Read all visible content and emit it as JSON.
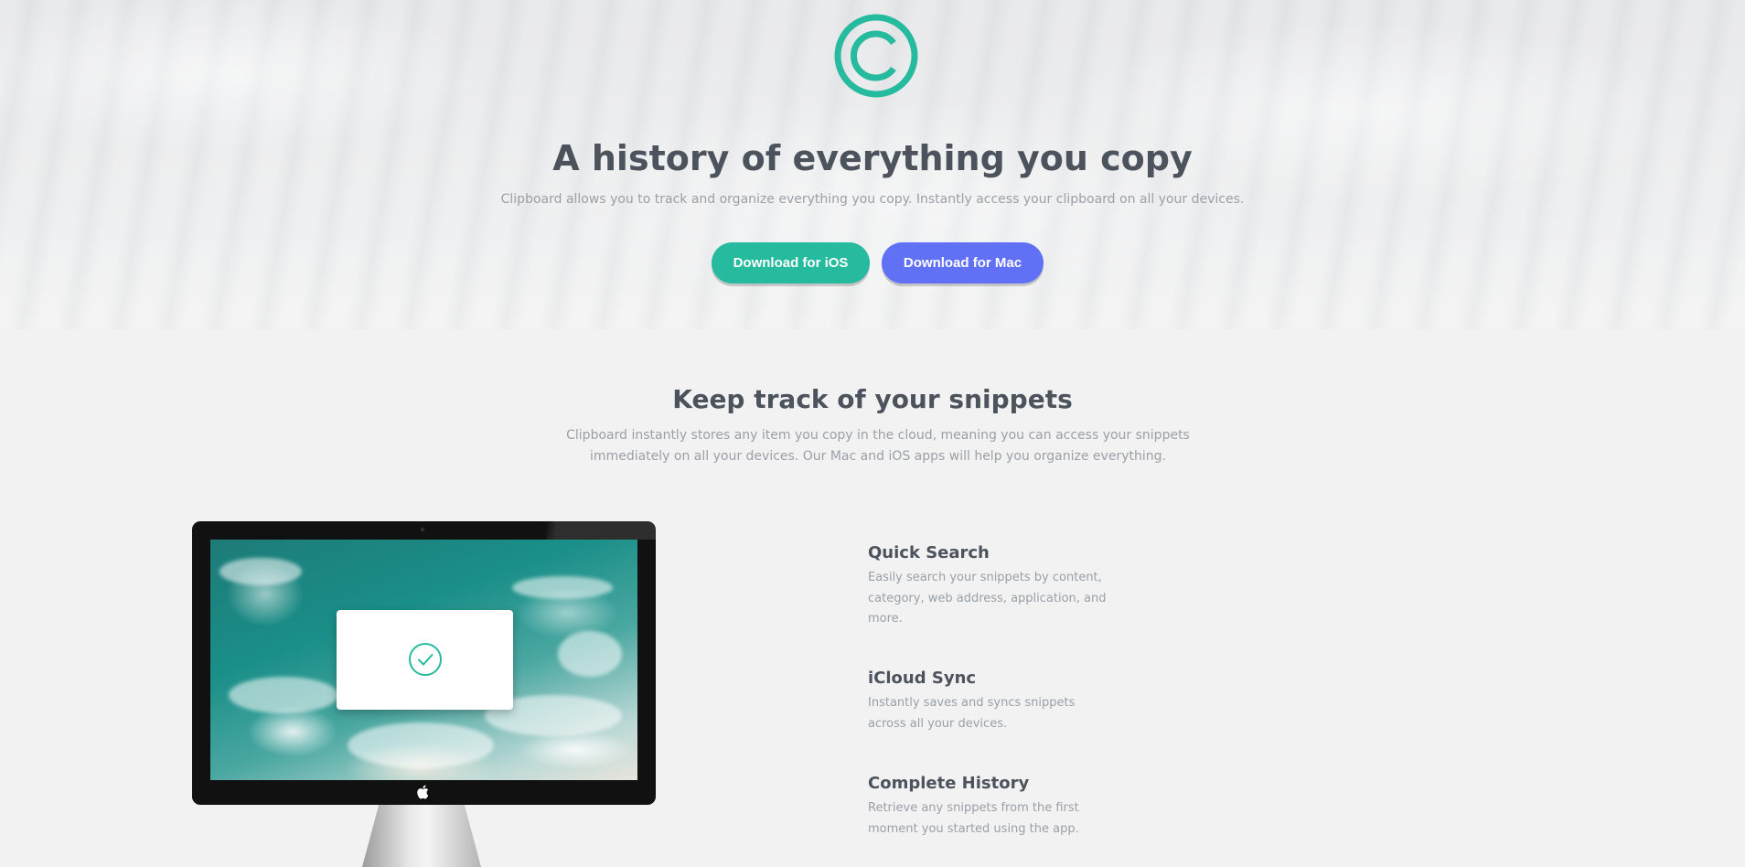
{
  "hero": {
    "logo_icon": "copyright-c-icon",
    "title": "A history of everything you copy",
    "subtitle": "Clipboard allows you to track and organize everything you copy. Instantly access your clipboard on all your devices.",
    "buttons": {
      "ios_label": "Download for iOS",
      "mac_label": "Download for Mac"
    }
  },
  "snippets": {
    "title": "Keep track of your snippets",
    "description": "Clipboard instantly stores any item you copy in the cloud, meaning you can access your snippets immediately on all your devices. Our Mac and iOS apps will help you organize everything."
  },
  "device": {
    "dialog_icon": "check-circle-icon",
    "brand_icon": "apple-icon"
  },
  "features": [
    {
      "title": "Quick Search",
      "description": "Easily search your snippets by content, category, web address, application, and more."
    },
    {
      "title": "iCloud Sync",
      "description": "Instantly saves and syncs snippets across all your devices."
    },
    {
      "title": "Complete History",
      "description": "Retrieve any snippets from the first moment you started using the app."
    }
  ],
  "colors": {
    "accent_green": "#26ba9e",
    "accent_blue": "#6171f6",
    "heading": "#4c535c",
    "body_text": "#9aa0a6",
    "background": "#f2f2f2"
  }
}
